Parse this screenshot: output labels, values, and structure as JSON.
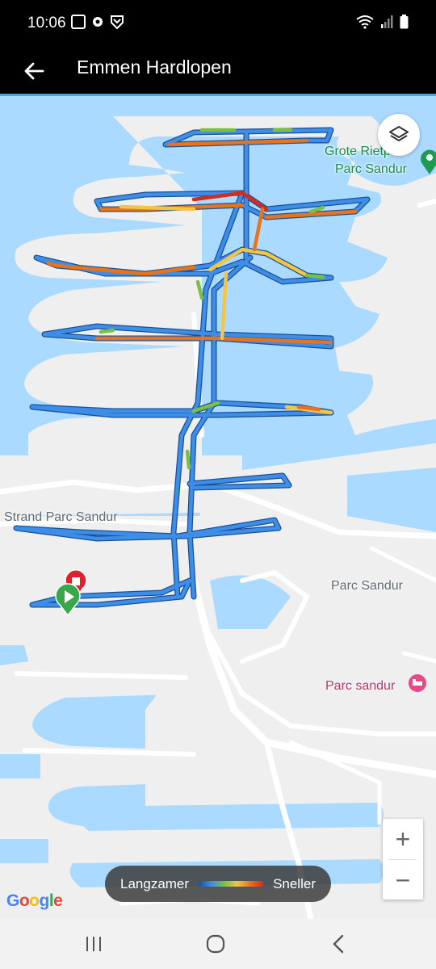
{
  "status_bar": {
    "time": "10:06",
    "notification_icons": [
      "news-icon",
      "settings-icon",
      "shield-icon"
    ],
    "right_icons": [
      "wifi-icon",
      "signal-icon",
      "battery-icon"
    ]
  },
  "app_bar": {
    "title": "Emmen Hardlopen",
    "back_icon": "arrow-back-icon"
  },
  "map": {
    "labels": {
      "grote_rietplas": "Grote Rietplas",
      "parc_sandur_top": "Parc Sandur",
      "strand": "Strand Parc Sandur",
      "parc_sandur_mid": "Parc Sandur",
      "parc_sandur_hotel": "Parc sandur"
    },
    "colors": {
      "water": "#aadaff",
      "land": "#efefef",
      "road": "#ffffff",
      "route_slow": "#2f7fe0",
      "route_fast": "#d62a1f"
    },
    "markers": {
      "start": "green-start-marker",
      "finish": "red-finish-marker"
    },
    "zoom_in_label": "+",
    "zoom_out_label": "−",
    "layers_icon": "layers-icon",
    "legend": {
      "slower": "Langzamer",
      "faster": "Sneller"
    },
    "attribution": "Google"
  },
  "nav_bar": {
    "recent_icon": "recent-apps-icon",
    "home_icon": "home-icon",
    "back_icon": "back-chevron-icon"
  }
}
